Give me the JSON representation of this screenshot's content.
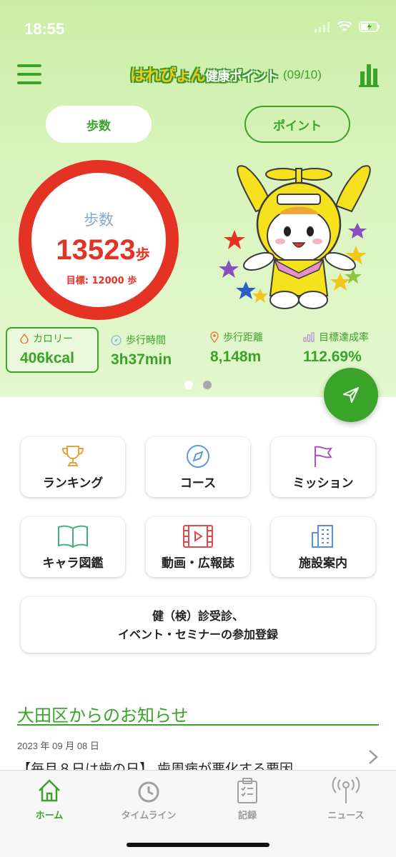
{
  "status_bar": {
    "time": "18:55"
  },
  "header": {
    "logo_text": "はれぴょん",
    "logo_sub": "健康ポイント",
    "date": "(09/10)"
  },
  "toggle": {
    "steps_label": "歩数",
    "points_label": "ポイント",
    "active": "steps"
  },
  "steps_ring": {
    "label": "歩数",
    "value": "13523",
    "unit": "歩",
    "goal": "目標: 12000 歩",
    "progress_fraction": 1.0,
    "color": "#e43325"
  },
  "stats": [
    {
      "label": "カロリー",
      "value": "406kcal",
      "icon": "flame-icon"
    },
    {
      "label": "歩行時間",
      "value": "3h37min",
      "icon": "compass-icon"
    },
    {
      "label": "歩行距離",
      "value": "8,148m",
      "icon": "location-pin-icon"
    },
    {
      "label": "目標達成率",
      "value": "112.69%",
      "icon": "bar-chart-icon"
    }
  ],
  "pager": {
    "pages": 2,
    "current": 1
  },
  "menu_tiles": [
    {
      "label": "ランキング",
      "icon": "trophy-icon"
    },
    {
      "label": "コース",
      "icon": "compass-icon"
    },
    {
      "label": "ミッション",
      "icon": "flag-icon"
    },
    {
      "label": "キャラ図鑑",
      "icon": "book-icon"
    },
    {
      "label": "動画・広報誌",
      "icon": "video-icon"
    },
    {
      "label": "施設案内",
      "icon": "building-icon"
    }
  ],
  "registration": {
    "line1": "健（検）診受診、",
    "line2": "イベント・セミナーの参加登録"
  },
  "news": {
    "section_title": "大田区からのお知らせ",
    "items": [
      {
        "date": "2023 年 09 月 08 日",
        "headline": "【毎月８日は歯の日】 歯周病が悪化する要因"
      }
    ]
  },
  "tabbar": [
    {
      "label": "ホーム",
      "icon": "home-icon",
      "active": true
    },
    {
      "label": "タイムライン",
      "icon": "clock-icon",
      "active": false
    },
    {
      "label": "記録",
      "icon": "clipboard-icon",
      "active": false
    },
    {
      "label": "ニュース",
      "icon": "antenna-icon",
      "active": false
    }
  ],
  "colors": {
    "accent": "#3aa329",
    "ring": "#e43325",
    "background_top": "#d9f4bd"
  }
}
